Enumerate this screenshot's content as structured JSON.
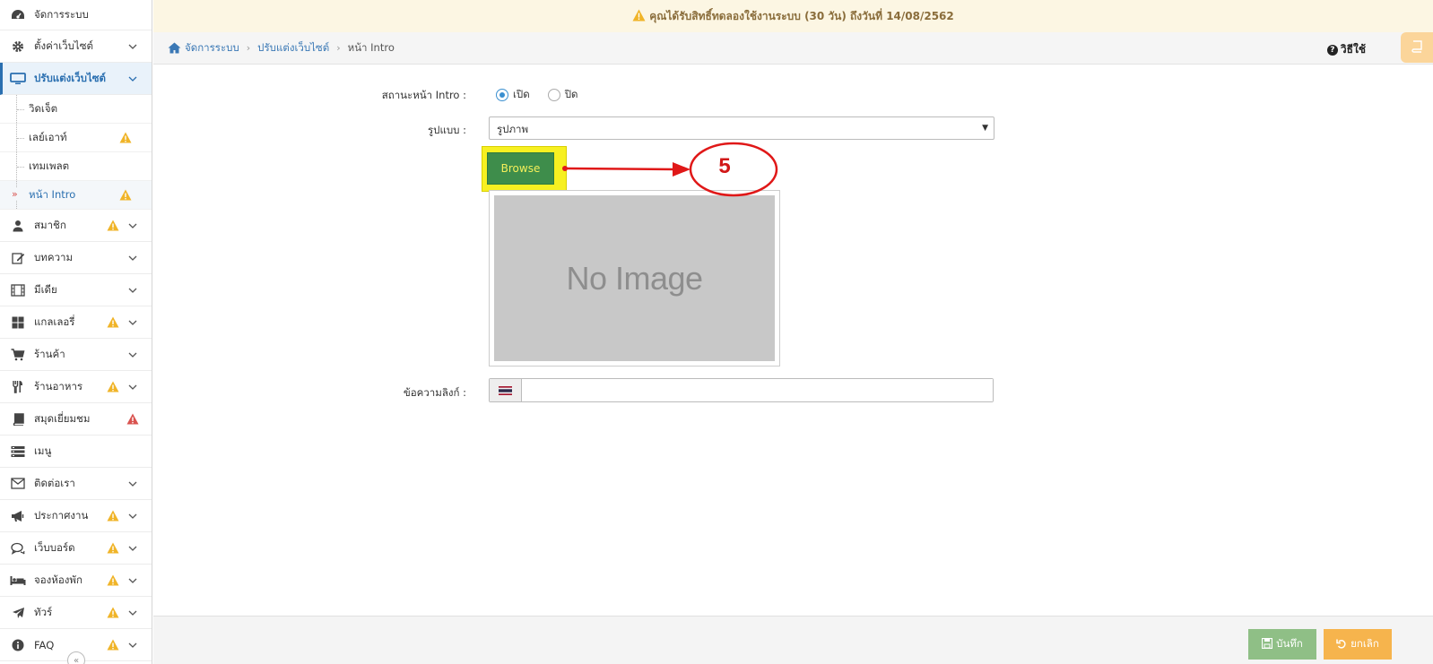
{
  "alert": {
    "text": "คุณได้รับสิทธิ์ทดลองใช้งานระบบ (30 วัน) ถึงวันที่ 14/08/2562",
    "icon": "warning-icon",
    "color": "#8a6d3b"
  },
  "breadcrumb": {
    "home": "จัดการระบบ",
    "section": "ปรับแต่งเว็บไซต์",
    "current": "หน้า Intro"
  },
  "help": {
    "label": "วิธีใช้"
  },
  "sidebar": {
    "items": [
      {
        "label": "จัดการระบบ",
        "icon": "dashboard-icon"
      },
      {
        "label": "ตั้งค่าเว็บไซต์",
        "icon": "gear-icon"
      },
      {
        "label": "ปรับแต่งเว็บไซต์",
        "icon": "monitor-icon"
      },
      {
        "label": "สมาชิก",
        "icon": "user-icon"
      },
      {
        "label": "บทความ",
        "icon": "edit-icon"
      },
      {
        "label": "มีเดีย",
        "icon": "film-icon"
      },
      {
        "label": "แกลเลอรี่",
        "icon": "grid-icon"
      },
      {
        "label": "ร้านค้า",
        "icon": "cart-icon"
      },
      {
        "label": "ร้านอาหาร",
        "icon": "utensils-icon"
      },
      {
        "label": "สมุดเยี่ยมชม",
        "icon": "book-icon"
      },
      {
        "label": "เมนู",
        "icon": "menu-icon"
      },
      {
        "label": "ติดต่อเรา",
        "icon": "envelope-icon"
      },
      {
        "label": "ประกาศงาน",
        "icon": "megaphone-icon"
      },
      {
        "label": "เว็บบอร์ด",
        "icon": "comments-icon"
      },
      {
        "label": "จองห้องพัก",
        "icon": "bed-icon"
      },
      {
        "label": "ทัวร์",
        "icon": "plane-icon"
      },
      {
        "label": "FAQ",
        "icon": "info-icon"
      }
    ],
    "sub": [
      {
        "label": "วิดเจ็ต"
      },
      {
        "label": "เลย์เอาท์"
      },
      {
        "label": "เทมเพลต"
      },
      {
        "label": "หน้า Intro"
      }
    ]
  },
  "form": {
    "status_label": "สถานะหน้า Intro :",
    "status_on": "เปิด",
    "status_off": "ปิด",
    "type_label": "รูปแบบ :",
    "type_value": "รูปภาพ",
    "browse_label": "Browse",
    "preview_text": "No Image",
    "link_label": "ข้อความลิงก์ :",
    "link_value": ""
  },
  "annotation": {
    "number": "5",
    "color": "#d11818"
  },
  "footer": {
    "save_label": "บันทึก",
    "cancel_label": "ยกเลิก"
  },
  "colors": {
    "accent": "#2a6fb0",
    "warning": "#f0b428",
    "danger": "#d9534f",
    "browse": "#3e8d4b"
  }
}
